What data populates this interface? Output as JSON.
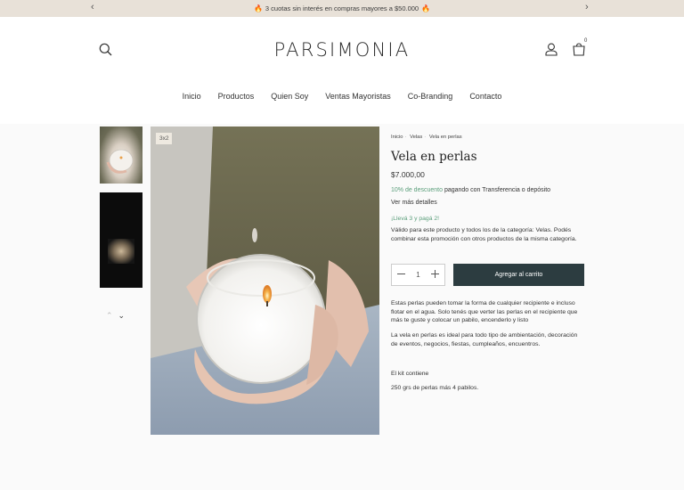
{
  "announcement": {
    "text": "3 cuotas sin interés en compras mayores a $50.000",
    "prev": "‹",
    "next": "›"
  },
  "header": {
    "logo": "PARSIMONIA",
    "cart_count": "0"
  },
  "nav": {
    "items": [
      "Inicio",
      "Productos",
      "Quien Soy",
      "Ventas Mayoristas",
      "Co-Branding",
      "Contacto"
    ]
  },
  "gallery": {
    "badge": "3x2",
    "nav_up": "⌃",
    "nav_down": "⌄"
  },
  "product": {
    "breadcrumb": [
      "Inicio",
      "Velas",
      "Vela en perlas"
    ],
    "title": "Vela en perlas",
    "price": "$7.000,00",
    "discount_highlight": "10% de descuento",
    "discount_rest": " pagando con Transferencia o depósito",
    "details_link": "Ver más detalles",
    "promo_title": "¡Llevá 3 y pagá 2!",
    "promo_desc": "Válido para este producto y todos los de la categoría: Velas. Podés combinar esta promoción con otros productos de la misma categoría.",
    "quantity": "1",
    "add_to_cart": "Agregar al carrito",
    "description": [
      "Estas perlas pueden tomar la forma de cualquier recipiente e incluso flotar en el agua. Solo tenés que verter las perlas en el recipiente que más te guste y colocar un pabilo, encenderlo y listo",
      "La vela en perlas es ideal para todo tipo de ambientación, decoración de eventos, negocios, fiestas, cumpleaños, encuentros.",
      "El kit contiene",
      "250 grs de perlas más 4 pabilos."
    ]
  },
  "colors": {
    "announce_bg": "#e8e1d8",
    "button_bg": "#2c3c40",
    "accent_green": "#5a9e7a"
  }
}
